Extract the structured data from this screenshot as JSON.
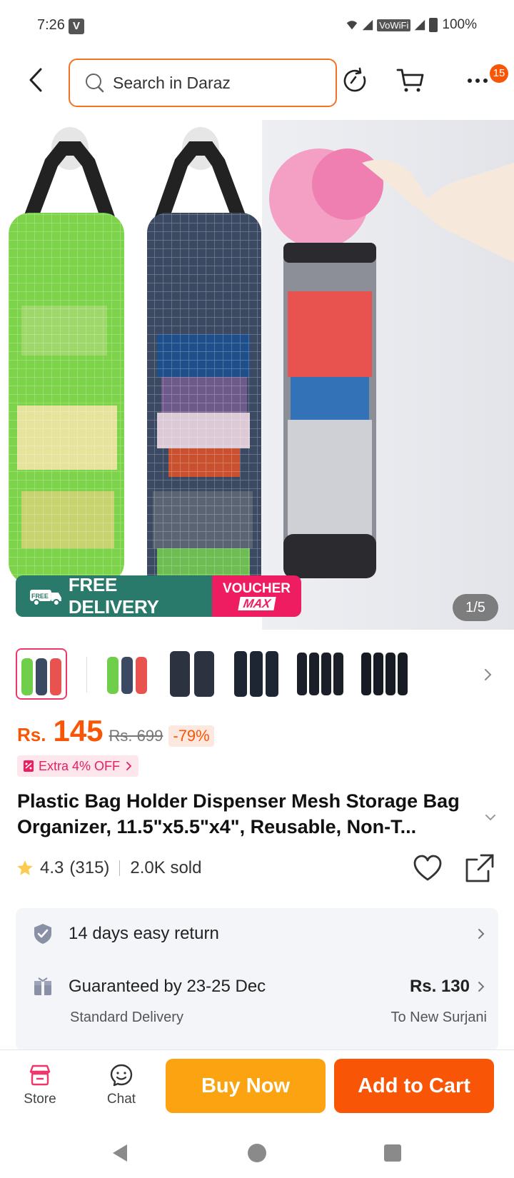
{
  "status_bar": {
    "time": "7:26",
    "carrier_badge": "V",
    "vowifi": "VoWiFi",
    "battery": "100%"
  },
  "header": {
    "search_placeholder": "Search in Daraz",
    "cart_badge": "15",
    "icons": [
      "back-arrow-icon",
      "search-icon",
      "history-icon",
      "cart-icon",
      "more-icon"
    ]
  },
  "gallery": {
    "counter": "1/5",
    "promo": {
      "free_badge": "FREE",
      "free_delivery": "FREE DELIVERY",
      "voucher_top": "VOUCHER",
      "voucher_bottom": "MAX"
    },
    "thumbnail_count": 6
  },
  "product": {
    "currency": "Rs.",
    "price": "145",
    "original_price": "Rs. 699",
    "discount": "-79%",
    "extra_offer": "Extra 4% OFF",
    "title": "Plastic Bag Holder Dispenser Mesh Storage Bag Organizer, 11.5\"x5.5\"x4\", Reusable, Non-T...",
    "rating": "4.3",
    "rating_count": "(315)",
    "sold": "2.0K sold"
  },
  "services": {
    "return": "14 days easy return",
    "delivery_guarantee": "Guaranteed by 23-25 Dec",
    "delivery_type": "Standard Delivery",
    "delivery_price": "Rs. 130",
    "delivery_to": "To New Surjani"
  },
  "bottom_bar": {
    "store": "Store",
    "chat": "Chat",
    "buy_now": "Buy Now",
    "add_to_cart": "Add to Cart"
  },
  "colors": {
    "brand_orange": "#f85606",
    "buy_now": "#fca311",
    "promo_green": "#2a7a6b",
    "promo_pink": "#ee1d62"
  }
}
